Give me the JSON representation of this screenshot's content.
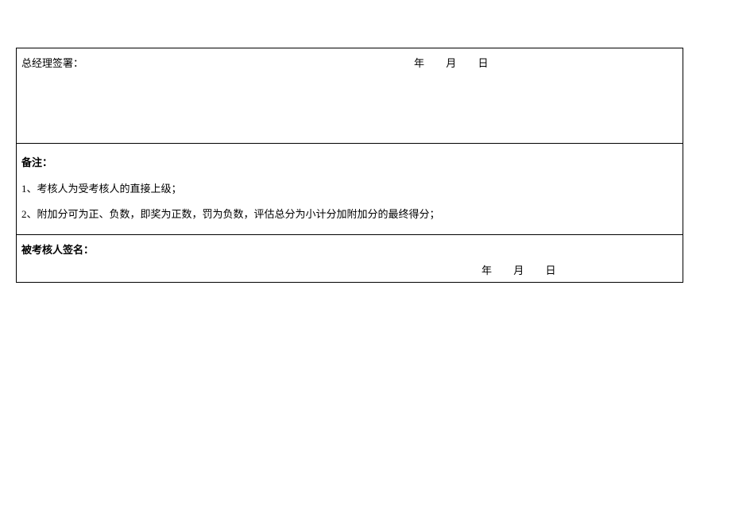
{
  "section1": {
    "label": "总经理签署：",
    "year": "年",
    "month": "月",
    "day": "日"
  },
  "section2": {
    "header": "备注：",
    "note1": "1、考核人为受考核人的直接上级；",
    "note2": "2、附加分可为正、负数，即奖为正数，罚为负数，评估总分为小计分加附加分的最终得分；"
  },
  "section3": {
    "label": "被考核人签名：",
    "year": "年",
    "month": "月",
    "day": "日"
  }
}
